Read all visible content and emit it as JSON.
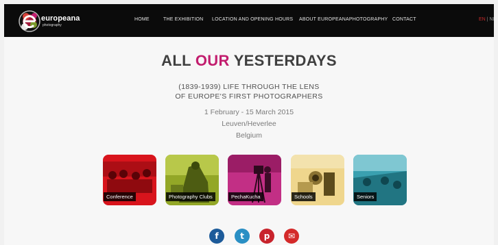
{
  "header": {
    "logo": {
      "name": "europeana",
      "sub": "photography"
    },
    "nav": [
      {
        "label": "HOME"
      },
      {
        "label": "THE EXHIBITION"
      },
      {
        "label": "LOCATION AND OPENING HOURS"
      },
      {
        "label": "ABOUT EUROPEANAPHOTOGRAPHY"
      },
      {
        "label": "CONTACT"
      }
    ],
    "languages": {
      "en": "EN",
      "separator": "|",
      "nl": "NL"
    }
  },
  "hero": {
    "title_part1": "ALL",
    "title_accent": "OUR",
    "title_part2": "YESTERDAYS",
    "subtitle_line1": "(1839-1939) LIFE THROUGH THE LENS",
    "subtitle_line2": "OF EUROPE'S FIRST PHOTOGRAPHERS",
    "dates": "1 February - 15 March 2015",
    "city": "Leuven/Heverlee",
    "country": "Belgium"
  },
  "tiles": [
    {
      "label": "Conference",
      "color": "#d8141c"
    },
    {
      "label": "Photography Clubs",
      "color": "#93a727"
    },
    {
      "label": "PechaKucha",
      "color": "#c22f85"
    },
    {
      "label": "Schools",
      "color": "#e6c36a"
    },
    {
      "label": "Seniors",
      "color": "#3aa0b0"
    }
  ],
  "social": [
    {
      "icon": "facebook-icon",
      "glyph": "f",
      "color": "#1d5b9a"
    },
    {
      "icon": "twitter-icon",
      "glyph": "t",
      "color": "#2a8fc4"
    },
    {
      "icon": "pinterest-icon",
      "glyph": "p",
      "color": "#c8232c"
    },
    {
      "icon": "email-icon",
      "glyph": "✉",
      "color": "#d42a2a"
    }
  ],
  "colors": {
    "accent": "#c21d6e",
    "nav_bg": "#0b0b0b",
    "lang_active": "#c72a2a"
  }
}
